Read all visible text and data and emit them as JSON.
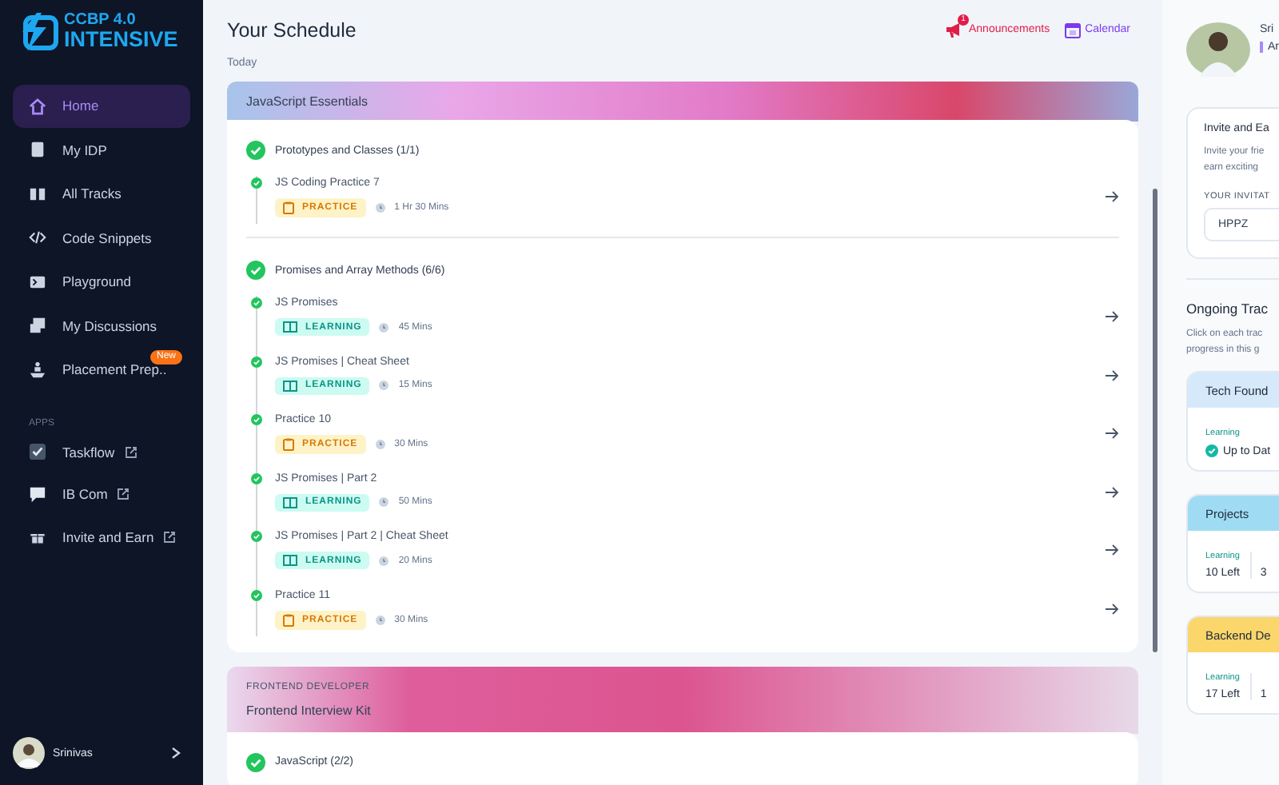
{
  "sidebar": {
    "logo": {
      "line1": "CCBP 4.0",
      "line2": "INTENSIVE"
    },
    "nav": [
      {
        "label": "Home",
        "selected": true
      },
      {
        "label": "My IDP",
        "selected": false
      },
      {
        "label": "All Tracks",
        "selected": false
      },
      {
        "label": "Code Snippets",
        "selected": false
      },
      {
        "label": "Playground",
        "selected": false
      },
      {
        "label": "My Discussions",
        "selected": false
      },
      {
        "label": "Placement Prep..",
        "selected": false,
        "badge": "New"
      }
    ],
    "apps_heading": "APPS",
    "apps": [
      {
        "label": "Taskflow"
      },
      {
        "label": "IB Com"
      },
      {
        "label": "Invite and Earn"
      }
    ],
    "user": {
      "name": "Srinivas"
    }
  },
  "schedule": {
    "title": "Your Schedule",
    "date": "Today",
    "links": [
      {
        "label": "Announcements",
        "kind": "announce",
        "badge": "1"
      },
      {
        "label": "Calendar",
        "kind": "calendar"
      }
    ],
    "tracks": [
      {
        "name": "JavaScript Essentials",
        "groups": [
          {
            "title": "Prototypes and Classes (1/1)",
            "done": true,
            "items": [
              {
                "title": "JS Coding Practice 7",
                "kind": "practice",
                "tag": "PRACTICE",
                "duration": "1 Hr 30 Mins",
                "done": true
              }
            ]
          },
          {
            "title": "Promises and Array Methods (6/6)",
            "done": true,
            "items": [
              {
                "title": "JS Promises",
                "kind": "learning",
                "tag": "LEARNING",
                "duration": "45 Mins",
                "done": true
              },
              {
                "title": "JS Promises | Cheat Sheet",
                "kind": "learning",
                "tag": "LEARNING",
                "duration": "15 Mins",
                "done": true
              },
              {
                "title": "Practice 10",
                "kind": "practice",
                "tag": "PRACTICE",
                "duration": "30 Mins",
                "done": true
              },
              {
                "title": "JS Promises | Part 2",
                "kind": "learning",
                "tag": "LEARNING",
                "duration": "50 Mins",
                "done": true
              },
              {
                "title": "JS Promises | Part 2 | Cheat Sheet",
                "kind": "learning",
                "tag": "LEARNING",
                "duration": "20 Mins",
                "done": true
              },
              {
                "title": "Practice 11",
                "kind": "practice",
                "tag": "PRACTICE",
                "duration": "30 Mins",
                "done": true
              }
            ]
          }
        ]
      },
      {
        "category": "FRONTEND DEVELOPER",
        "name": "Frontend Interview Kit",
        "groups": [
          {
            "title": "JavaScript (2/2)",
            "done": true
          }
        ]
      }
    ]
  },
  "profile": {
    "name": "Sri",
    "role": "Ar"
  },
  "invite": {
    "title": "Invite and Ea",
    "text_1": "Invite your frie",
    "text_2": "earn exciting",
    "code_label": "YOUR INVITAT",
    "code": "HPPZ"
  },
  "ongoing": {
    "title": "Ongoing Trac",
    "text_1": "Click on each trac",
    "text_2": "progress in this g",
    "tracks": [
      {
        "name": "Tech Found",
        "color": "#d6e9fb",
        "stats": [
          {
            "label": "Learning",
            "value": "Up to Dat",
            "kind": "done"
          }
        ]
      },
      {
        "name": "Projects",
        "color": "#9fdcf3",
        "stats": [
          {
            "label": "Learning",
            "value": "10 Left",
            "kind": "count"
          },
          {
            "value": "3",
            "kind": "count"
          }
        ]
      },
      {
        "name": "Backend De",
        "color": "#fbd66a",
        "stats": [
          {
            "label": "Learning",
            "value": "17 Left",
            "kind": "count"
          },
          {
            "value": "1",
            "kind": "count"
          }
        ]
      }
    ]
  }
}
